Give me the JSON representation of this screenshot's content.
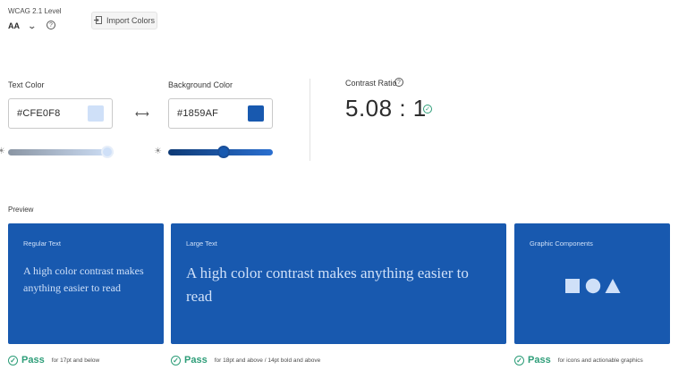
{
  "wcag": {
    "label": "WCAG 2.1 Level",
    "value": "AA",
    "help_icon": "question-icon"
  },
  "import_button": {
    "label": "Import Colors",
    "icon": "import-icon"
  },
  "text_color": {
    "label": "Text Color",
    "value": "#CFE0F8",
    "swatch": "#cfe0f8",
    "slider_level": 0.97
  },
  "background_color": {
    "label": "Background Color",
    "value": "#1859AF",
    "swatch": "#1859af",
    "slider_level": 0.53
  },
  "swap_icon": "swap-arrows-icon",
  "contrast": {
    "label": "Contrast Ratio",
    "value": "5.08 : 1",
    "status": "pass"
  },
  "preview": {
    "label": "Preview",
    "cards": [
      {
        "title": "Regular Text",
        "text": "A high color contrast makes anything easier to read",
        "pass": "Pass",
        "note": "for 17pt and below"
      },
      {
        "title": "Large Text",
        "text": "A high color contrast makes anything easier to read",
        "pass": "Pass",
        "note": "for 18pt and above / 14pt bold and above"
      },
      {
        "title": "Graphic Components",
        "shapes": [
          "square",
          "circle",
          "triangle"
        ],
        "pass": "Pass",
        "note": "for icons and actionable graphics"
      }
    ]
  },
  "colors": {
    "card_bg": "#1859af",
    "card_fg": "#cfe0f8",
    "pass_green": "#2d9d78"
  }
}
